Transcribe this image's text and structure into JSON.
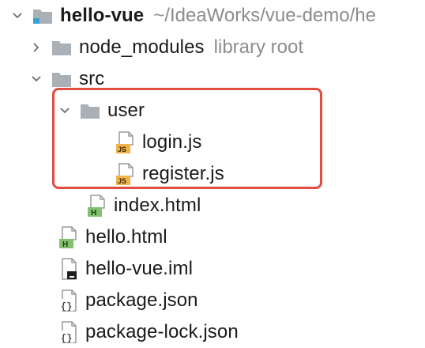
{
  "tree": {
    "root": {
      "label": "hello-vue",
      "path": "~/IdeaWorks/vue-demo/he",
      "icon": "module-folder-icon"
    },
    "items": [
      {
        "label": "node_modules",
        "hint": "library root",
        "icon": "folder-icon"
      },
      {
        "label": "src",
        "icon": "folder-icon"
      },
      {
        "label": "user",
        "icon": "folder-icon"
      },
      {
        "label": "login.js",
        "icon": "javascript-file-icon"
      },
      {
        "label": "register.js",
        "icon": "javascript-file-icon"
      },
      {
        "label": "index.html",
        "icon": "html-file-icon"
      },
      {
        "label": "hello.html",
        "icon": "html-file-icon"
      },
      {
        "label": "hello-vue.iml",
        "icon": "iml-file-icon"
      },
      {
        "label": "package.json",
        "icon": "json-file-icon"
      },
      {
        "label": "package-lock.json",
        "icon": "json-file-icon"
      }
    ]
  },
  "colors": {
    "highlight": "#e24d42",
    "folder": "#a9b0b6",
    "module_accent": "#3aa0d8",
    "js_badge": "#f0b44a",
    "html_badge": "#82c26e"
  }
}
